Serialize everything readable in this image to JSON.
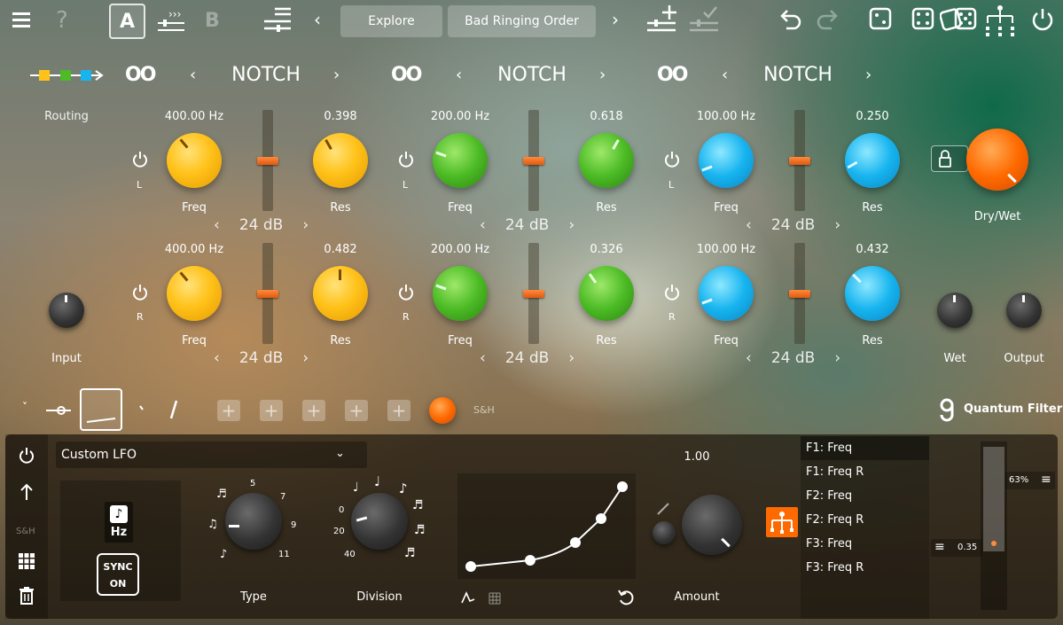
{
  "toolbar": {
    "preset_a": "A",
    "preset_b": "B",
    "explore": "Explore",
    "preset_name": "Bad Ringing Order",
    "prev": "‹",
    "next": "›"
  },
  "filters": [
    {
      "type": "NOTCH",
      "color": "yellow",
      "L": {
        "freq": "400.00 Hz",
        "res": "0.398",
        "gain": "24 dB"
      },
      "R": {
        "freq": "400.00 Hz",
        "res": "0.482",
        "gain": "24 dB"
      }
    },
    {
      "type": "NOTCH",
      "color": "green",
      "L": {
        "freq": "200.00 Hz",
        "res": "0.618",
        "gain": "24 dB"
      },
      "R": {
        "freq": "200.00 Hz",
        "res": "0.326",
        "gain": "24 dB"
      }
    },
    {
      "type": "NOTCH",
      "color": "blue",
      "L": {
        "freq": "100.00 Hz",
        "res": "0.250",
        "gain": "24 dB"
      },
      "R": {
        "freq": "100.00 Hz",
        "res": "0.432",
        "gain": "24 dB"
      }
    }
  ],
  "labels": {
    "routing": "Routing",
    "freq": "Freq",
    "res": "Res",
    "L": "L",
    "R": "R",
    "input": "Input",
    "wet": "Wet",
    "output": "Output",
    "drywet": "Dry/Wet",
    "sh": "S&H",
    "brand": "Quantum Filter",
    "link": "OO"
  },
  "lfo": {
    "name": "Custom LFO",
    "rate_unit": "Hz",
    "sync_label": "SYNC",
    "sync_state": "ON",
    "type_label": "Type",
    "division_label": "Division",
    "amount_label": "Amount",
    "amount_value": "1.00",
    "sh_side": "S&H",
    "type_ticks": [
      "5",
      "7",
      "9",
      "11"
    ],
    "division_ticks": [
      "0",
      "20",
      "40"
    ]
  },
  "targets": [
    "F1: Freq",
    "F1: Freq R",
    "F2: Freq",
    "F2: Freq R",
    "F3: Freq",
    "F3: Freq R"
  ],
  "meter": {
    "percent": "63%",
    "value": "0.35"
  },
  "colors": {
    "accent": "#ff6a00",
    "yellow": "#ffc21a",
    "green": "#4cbb25",
    "blue": "#17b4ef"
  }
}
